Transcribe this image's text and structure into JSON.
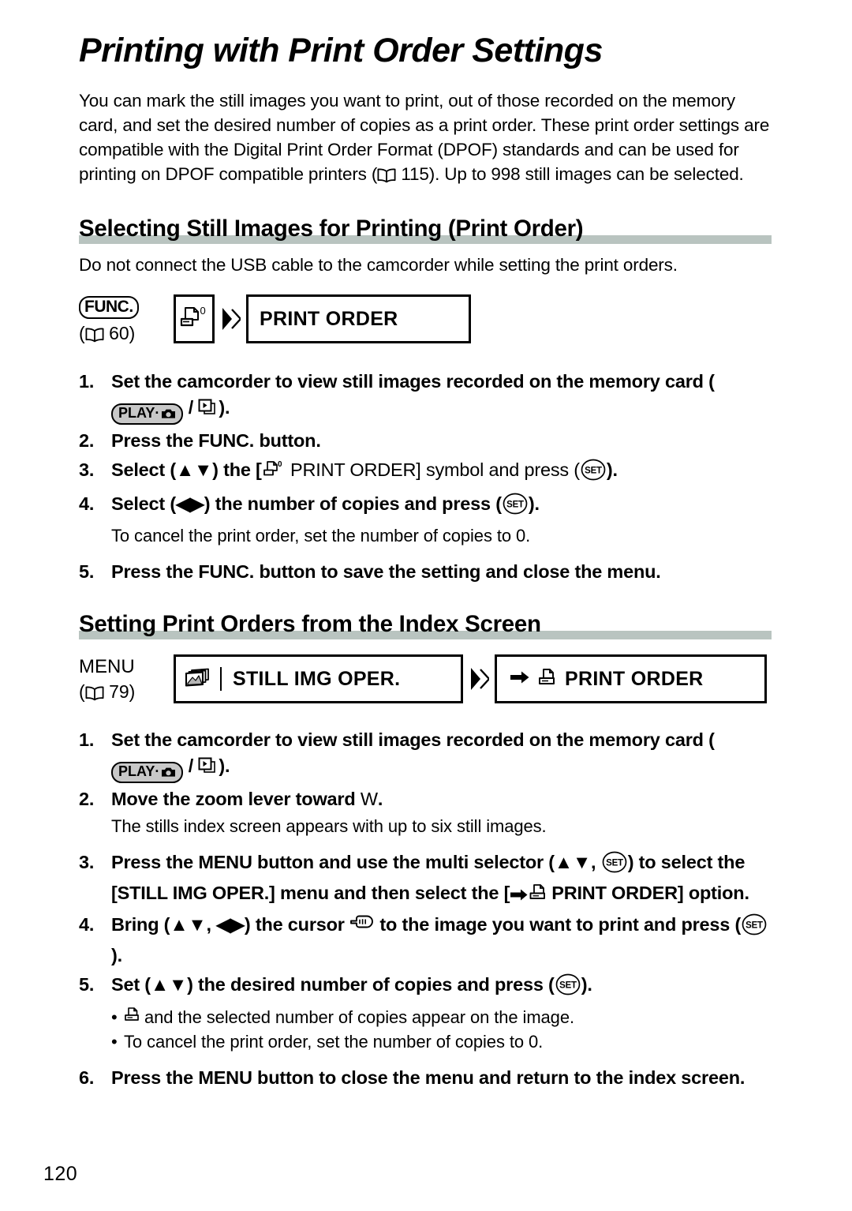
{
  "page": {
    "title": "Printing with Print Order Settings",
    "number": "120"
  },
  "intro": {
    "text_before_ref": "You can mark the still images you want to print, out of those recorded on the memory card, and set the desired number of copies as a print order. These print order settings are compatible with the Digital Print Order Format (DPOF) standards and can be used for printing on DPOF compatible printers (",
    "ref_page": "115",
    "text_after_ref": "). Up to 998 still images can be selected."
  },
  "section1": {
    "heading": "Selecting Still Images for Printing (Print Order)",
    "note": "Do not connect the USB cable to the camcorder while setting the print orders.",
    "menu_path": {
      "button_label": "FUNC.",
      "ref_page": "60",
      "print_order_label": "PRINT ORDER",
      "print_order_superscript": "0"
    },
    "steps": [
      {
        "num": "1.",
        "text_a": "Set the camcorder to view still images recorded on the memory card (",
        "badge": "PLAY·",
        "text_b": " / ",
        "text_c": ")."
      },
      {
        "num": "2.",
        "text": "Press the FUNC. button."
      },
      {
        "num": "3.",
        "text_a": "Select (",
        "dirs": "▲▼",
        "text_b": ") the [",
        "text_c": " PRINT ORDER] symbol and press (",
        "set": "SET",
        "text_d": ")."
      },
      {
        "num": "4.",
        "text_a": "Select (",
        "dirs": "◀▶",
        "text_b": ") the number of copies and press (",
        "set": "SET",
        "text_d": ")."
      },
      {
        "num": "4sub",
        "text": "To cancel the print order, set the number of copies to 0."
      },
      {
        "num": "5.",
        "text": "Press the FUNC. button to save the setting and close the menu."
      }
    ]
  },
  "section2": {
    "heading": "Setting Print Orders from the Index Screen",
    "menu_path": {
      "button_label": "MENU",
      "ref_page": "79",
      "still_img_oper_label": "STILL IMG OPER.",
      "print_order_label": "PRINT ORDER"
    },
    "steps": [
      {
        "num": "1.",
        "text_a": "Set the camcorder to view still images recorded on the memory card (",
        "badge": "PLAY·",
        "text_b": " / ",
        "text_c": ")."
      },
      {
        "num": "2.",
        "text_a": "Move the zoom lever toward ",
        "emph": "W",
        "text_b": "."
      },
      {
        "num": "2sub",
        "text": "The stills index screen appears with up to six still images."
      },
      {
        "num": "3.",
        "text_a": "Press the MENU button and use the multi selector (",
        "dirs": "▲▼",
        "text_b": ", ",
        "set": "SET",
        "text_c": ") to select the [STILL IMG OPER.] menu and then select the [",
        "text_d": "PRINT ORDER] option."
      },
      {
        "num": "4.",
        "text_a": "Bring (",
        "dirs_a": "▲▼",
        "text_b": ", ",
        "dirs_b": "◀▶",
        "text_c": ") the cursor ",
        "text_d": " to the image you want to print and press (",
        "set": "SET",
        "text_e": ")."
      },
      {
        "num": "5.",
        "text_a": "Set (",
        "dirs": "▲▼",
        "text_b": ") the desired number of copies and press (",
        "set": "SET",
        "text_c": ")."
      },
      {
        "num": "5b1",
        "text": " and the selected number of copies appear on the image."
      },
      {
        "num": "5b2",
        "text": "To cancel the print order, set the number of copies to 0."
      },
      {
        "num": "6.",
        "text": "Press the MENU button to close the menu and return to the index screen."
      }
    ]
  },
  "icons": {
    "book": "book-icon",
    "printer": "printer-icon",
    "camera": "camera-icon",
    "card": "card-playback-icon",
    "photos": "stacked-photos-icon",
    "chevron": "double-chevron-right-icon",
    "arrow": "right-arrow-icon",
    "hand": "pointing-hand-cursor-icon",
    "set": "set-button-icon"
  },
  "colors": {
    "rule": "#b9c4c0",
    "badge_fill": "#c8c8c8",
    "ink": "#000000"
  }
}
